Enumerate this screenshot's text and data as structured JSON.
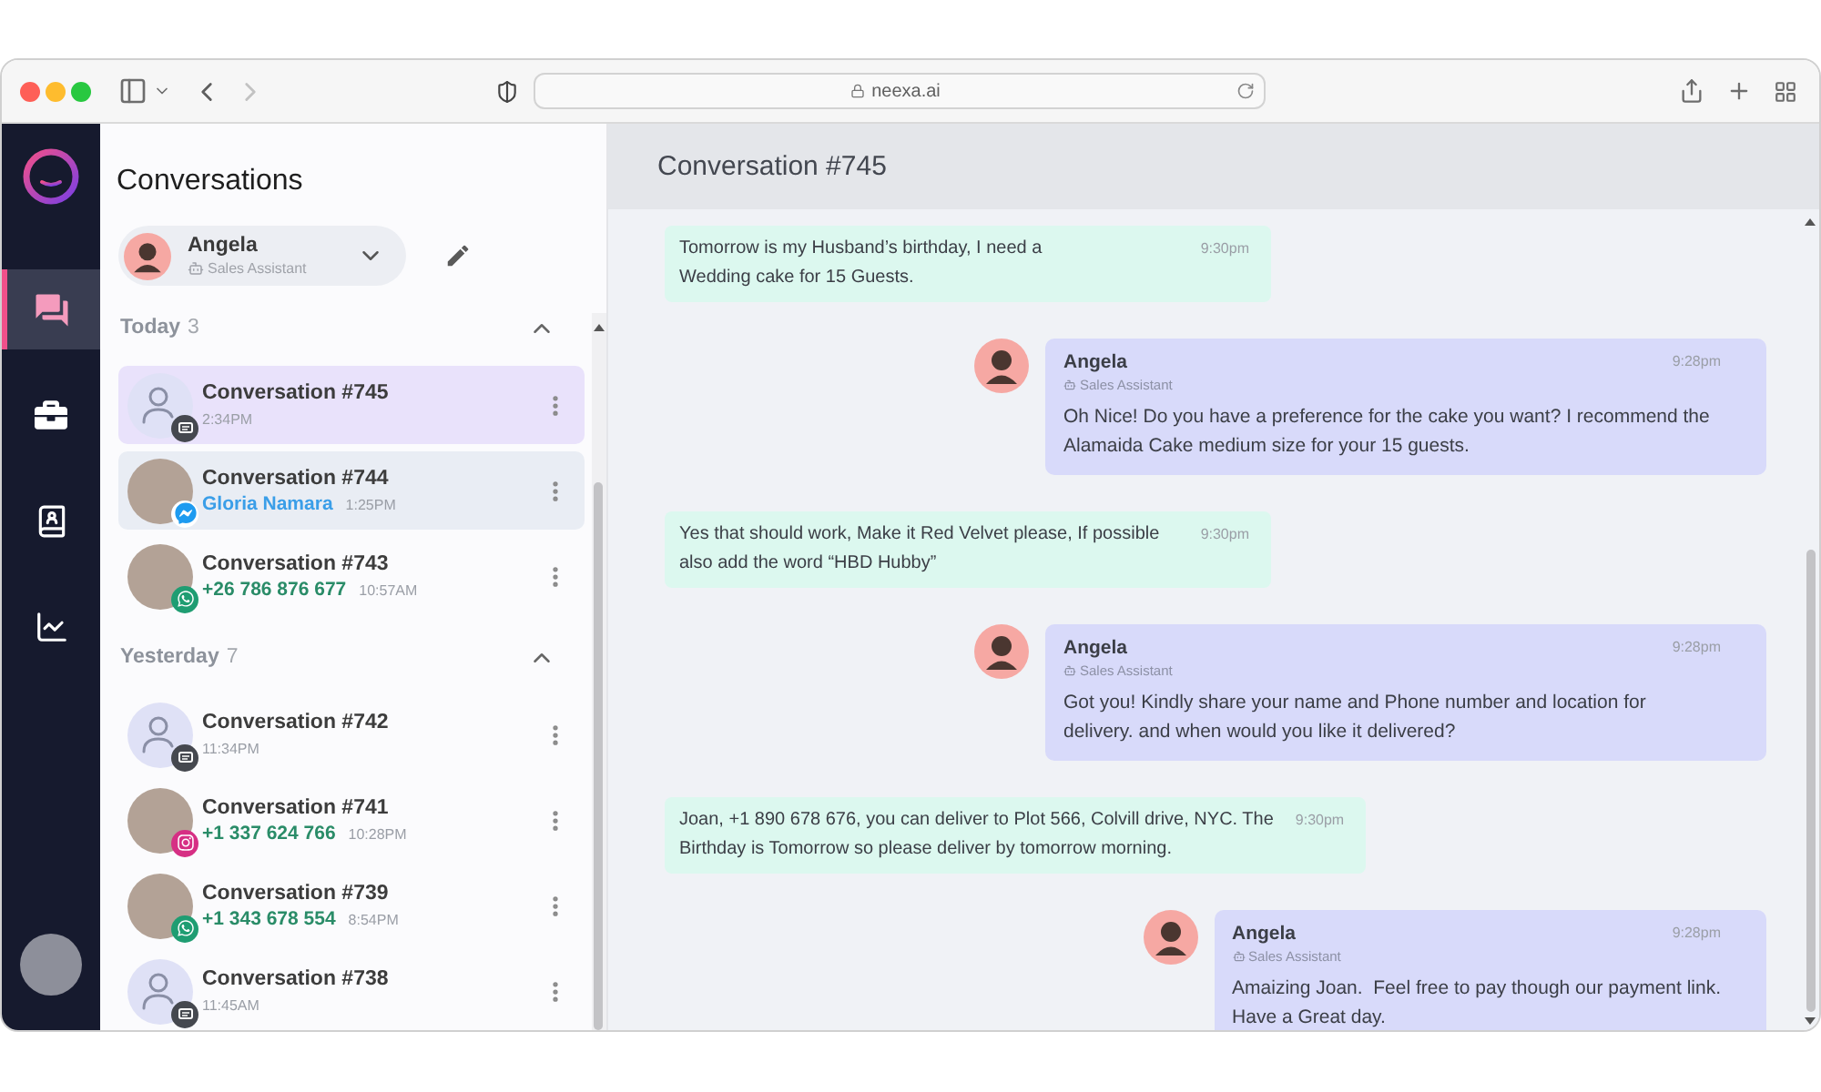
{
  "browser": {
    "url": "neexa.ai",
    "back": {
      "disabled": false
    },
    "forward": {
      "disabled": true
    }
  },
  "nav": [
    {
      "kind": "chats",
      "selected": true
    },
    {
      "kind": "briefcase",
      "selected": false
    },
    {
      "kind": "contacts",
      "selected": false
    },
    {
      "kind": "analytics",
      "selected": false
    }
  ],
  "conversations_panel": {
    "title": "Conversations",
    "agent": {
      "name": "Angela",
      "role": "Sales Assistant"
    },
    "groups": [
      {
        "label": "Today",
        "count": "3",
        "expanded": true,
        "conversations": [
          {
            "kind": "webchat",
            "title": "Conversation #745",
            "time": "2:34PM",
            "selected": true,
            "hovered": false
          },
          {
            "kind": "messenger",
            "title": "Conversation #744",
            "contact": "Gloria Namara",
            "time": "1:25PM",
            "selected": false,
            "hovered": true
          },
          {
            "kind": "whatsapp",
            "title": "Conversation #743",
            "contact": "+26 786 876 677",
            "time": "10:57AM",
            "selected": false,
            "hovered": false
          }
        ]
      },
      {
        "label": "Yesterday",
        "count": "7",
        "expanded": true,
        "conversations": [
          {
            "kind": "webchat",
            "title": "Conversation #742",
            "time": "11:34PM",
            "selected": false,
            "hovered": false
          },
          {
            "kind": "instagram",
            "title": "Conversation #741",
            "contact": "+1 337 624 766",
            "time": "10:28PM",
            "selected": false,
            "hovered": false
          },
          {
            "kind": "whatsapp",
            "title": "Conversation #739",
            "contact": "+1 343 678 554",
            "time": "8:54PM",
            "selected": false,
            "hovered": false
          },
          {
            "kind": "webchat",
            "title": "Conversation #738",
            "time": "11:45AM",
            "selected": false,
            "hovered": false
          }
        ]
      }
    ]
  },
  "chat": {
    "title": "Conversation #745",
    "messages": [
      {
        "kind": "customer",
        "text": "Tomorrow is my Husband’s birthday, I need a\nWedding cake for 15 Guests.",
        "time": "9:30pm"
      },
      {
        "kind": "agent",
        "sender": "Angela",
        "role": "Sales Assistant",
        "text": "Oh Nice! Do you have a preference for the cake you want? I recommend the Alamaida Cake medium size for your 15 guests.",
        "time": "9:28pm"
      },
      {
        "kind": "customer",
        "text": "Yes that should work, Make it Red Velvet please, If possible\nalso add the word “HBD Hubby”",
        "time": "9:30pm"
      },
      {
        "kind": "agent",
        "sender": "Angela",
        "role": "Sales Assistant",
        "text": "Got you! Kindly share your name and Phone number and location for delivery. and when would you like it delivered?",
        "time": "9:28pm"
      },
      {
        "kind": "customer",
        "text": "Joan, +1 890 678 676, you can deliver to Plot 566, Colvill drive, NYC. The\nBirthday is Tomorrow so please deliver by tomorrow morning.",
        "time": "9:30pm"
      },
      {
        "kind": "agent",
        "sender": "Angela",
        "role": "Sales Assistant",
        "text": "Amaizing Joan.  Feel free to pay though our payment link.\nHave a Great day.",
        "time": "9:28pm"
      }
    ]
  }
}
